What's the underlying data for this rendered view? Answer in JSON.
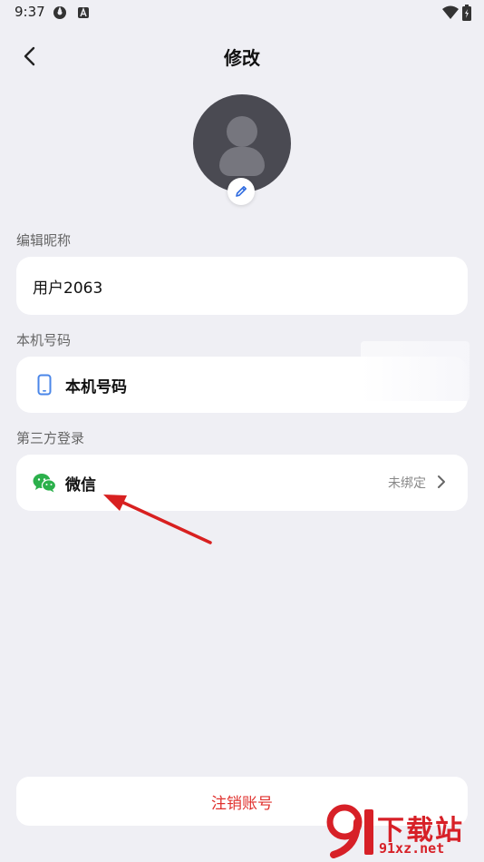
{
  "status_bar": {
    "time": "9:37"
  },
  "header": {
    "title": "修改"
  },
  "sections": {
    "nickname": {
      "label": "编辑昵称",
      "value": "用户2063"
    },
    "phone": {
      "label": "本机号码",
      "item_label": "本机号码"
    },
    "third_party": {
      "label": "第三方登录",
      "wechat_label": "微信",
      "wechat_status": "未绑定"
    }
  },
  "footer": {
    "cancel_account_label": "注销账号"
  },
  "watermark": {
    "title": "下载站",
    "url": "91xz.net"
  },
  "colors": {
    "background": "#EFEFF4",
    "danger": "#E0312E",
    "wechat_green": "#2BB04B",
    "accent_blue": "#2F6BE0",
    "annotation_red": "#D82020"
  },
  "icons": {
    "back": "chevron-left-icon",
    "edit": "pencil-icon",
    "phone": "phone-icon",
    "wechat": "wechat-icon",
    "chevron": "chevron-right-icon"
  }
}
